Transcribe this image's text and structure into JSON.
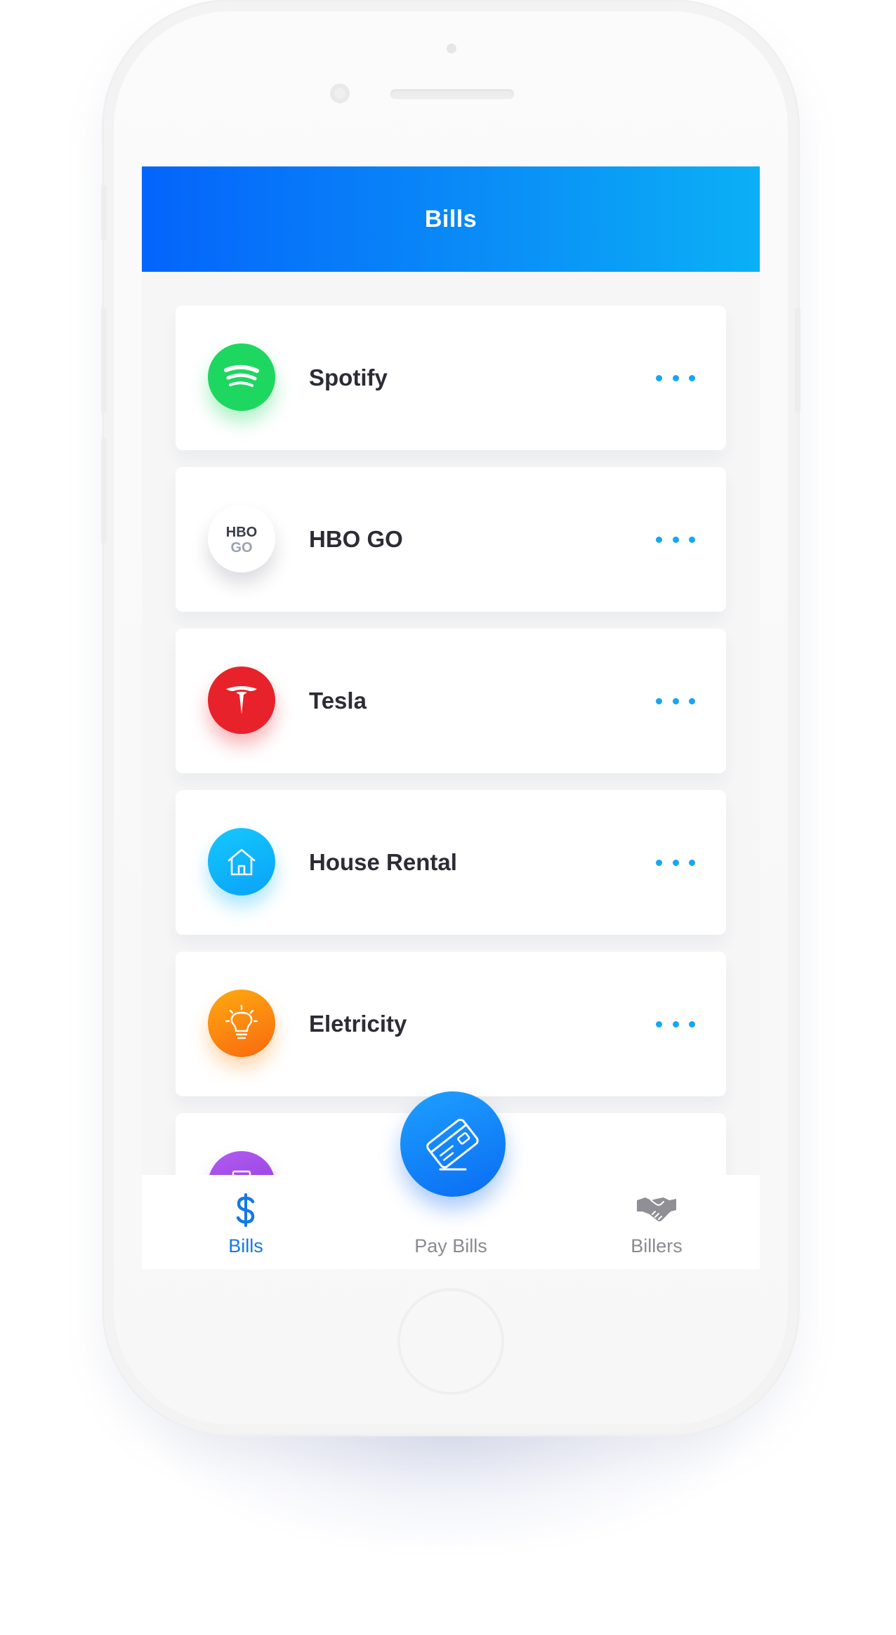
{
  "header": {
    "title": "Bills"
  },
  "bills": [
    {
      "label": "Spotify",
      "icon": "spotify-logo-icon",
      "color": "#1ed760"
    },
    {
      "label": "HBO GO",
      "icon": "hbo-go-logo-icon",
      "color": "#ffffff",
      "logo_text_top": "HBO",
      "logo_text_bottom": "GO"
    },
    {
      "label": "Tesla",
      "icon": "tesla-logo-icon",
      "color": "#e8222a"
    },
    {
      "label": "House Rental",
      "icon": "house-icon",
      "color": "#16b8fb"
    },
    {
      "label": "Eletricity",
      "icon": "lightbulb-icon",
      "color": "#fb8c14"
    },
    {
      "label": "",
      "icon": "document-icon",
      "color": "#a346e8"
    }
  ],
  "more_icon": "ellipsis-icon",
  "accent_color": "#15a6f5",
  "tabbar": {
    "tabs": [
      {
        "label": "Bills",
        "icon": "dollar-icon",
        "active": true,
        "color": "#1478e6"
      },
      {
        "label": "Pay Bills",
        "icon": "credit-card-icon",
        "active": false,
        "color": "#8a8a90"
      },
      {
        "label": "Billers",
        "icon": "handshake-icon",
        "active": false,
        "color": "#8a8a90"
      }
    ]
  }
}
